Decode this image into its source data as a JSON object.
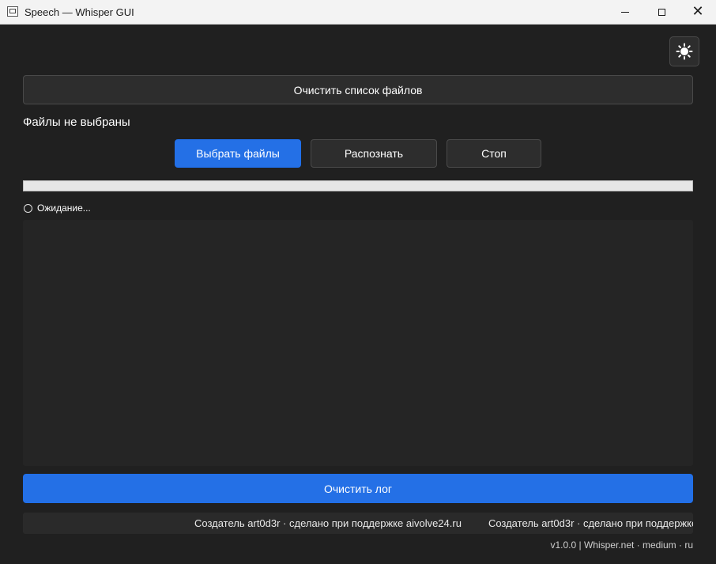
{
  "window": {
    "title": "Speech — Whisper GUI",
    "icon": "app-window-icon"
  },
  "toolbar": {
    "theme_icon": "sun-icon"
  },
  "files": {
    "clear_list_label": "Очистить список файлов",
    "status_text": "Файлы не выбраны",
    "choose_label": "Выбрать файлы",
    "recognize_label": "Распознать",
    "stop_label": "Стоп"
  },
  "progress": {
    "value_percent": 0,
    "status_text": "Ожидание..."
  },
  "log": {
    "clear_label": "Очистить лог"
  },
  "footer": {
    "marquee_text": "Создатель art0d3r  ·  сделано при поддержке aivolve24.ru",
    "version_text": "v1.0.0 | Whisper.net · medium · ru"
  },
  "colors": {
    "background": "#202020",
    "accent": "#2470e6",
    "button": "#2d2d2d"
  }
}
